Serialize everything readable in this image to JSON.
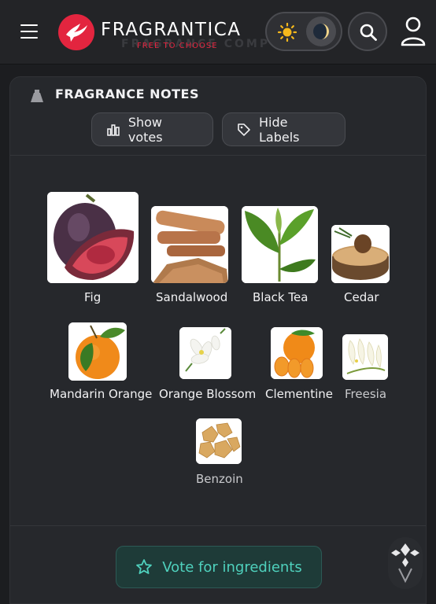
{
  "header": {
    "brand": "FRAGRANTICA",
    "tagline": "FREE TO CHOOSE",
    "ghost_text": "FRAGRANCE COMPOSITION",
    "menu_icon": "hamburger-icon",
    "theme_sun_icon": "sun-icon",
    "theme_moon_icon": "moon-icon",
    "search_icon": "search-icon",
    "user_icon": "user-icon"
  },
  "card": {
    "title": "FRAGRANCE NOTES",
    "show_votes_label": "Show votes",
    "hide_labels_label": "Hide Labels",
    "vote_label": "Vote for ingredients"
  },
  "notes": [
    {
      "name": "Fig"
    },
    {
      "name": "Sandalwood"
    },
    {
      "name": "Black Tea"
    },
    {
      "name": "Cedar"
    },
    {
      "name": "Mandarin Orange"
    },
    {
      "name": "Orange Blossom"
    },
    {
      "name": "Clementine"
    },
    {
      "name": "Freesia"
    },
    {
      "name": "Benzoin"
    }
  ],
  "colors": {
    "brand_red": "#e3253f",
    "accent_teal": "#4fd1bd",
    "background": "#1c1d20",
    "card": "#26282c"
  }
}
